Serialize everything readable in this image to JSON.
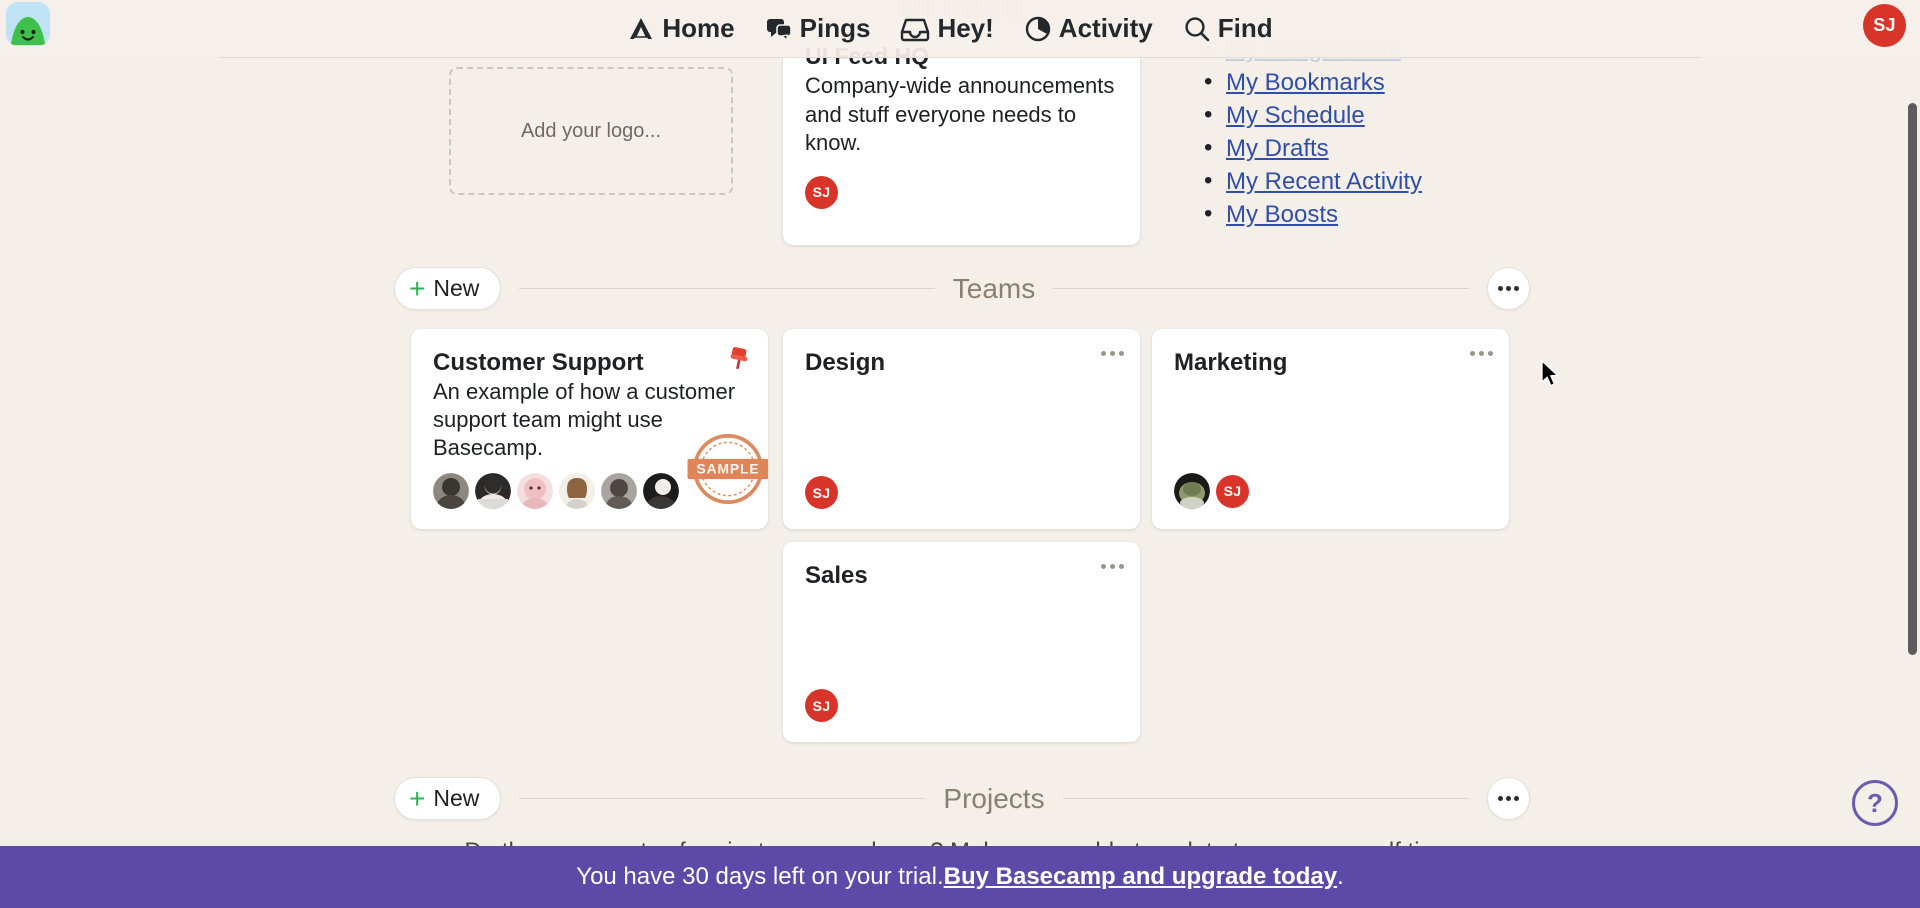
{
  "page": {
    "ghost_title": "UI Feed"
  },
  "header": {
    "logo_name": "basecamp-logo",
    "nav": [
      {
        "label": "Home",
        "icon": "home-icon"
      },
      {
        "label": "Pings",
        "icon": "pings-icon"
      },
      {
        "label": "Hey!",
        "icon": "hey-inbox-icon"
      },
      {
        "label": "Activity",
        "icon": "activity-icon"
      },
      {
        "label": "Find",
        "icon": "search-icon"
      }
    ],
    "avatar_initials": "SJ"
  },
  "logo_drop": {
    "label": "Add your logo..."
  },
  "hq_card": {
    "title": "UI Feed HQ",
    "description": "Company-wide announcements and stuff everyone needs to know.",
    "member_initials": "SJ"
  },
  "my_links": [
    {
      "label": "My Assignments",
      "dimmed": true
    },
    {
      "label": "My Bookmarks",
      "dimmed": false
    },
    {
      "label": "My Schedule",
      "dimmed": false
    },
    {
      "label": "My Drafts",
      "dimmed": false
    },
    {
      "label": "My Recent Activity",
      "dimmed": false
    },
    {
      "label": "My Boosts",
      "dimmed": false
    }
  ],
  "teams_section": {
    "new_label": "New",
    "title": "Teams",
    "menu_icon": "ellipsis-icon"
  },
  "teams": [
    {
      "name": "Customer Support",
      "description": "An example of how a customer support team might use Basecamp.",
      "pinned": true,
      "sample": true,
      "sample_label": "SAMPLE",
      "avatar_count": 6,
      "initials": []
    },
    {
      "name": "Design",
      "description": "",
      "pinned": false,
      "sample": false,
      "avatar_count": 0,
      "initials": [
        "SJ"
      ]
    },
    {
      "name": "Marketing",
      "description": "",
      "pinned": false,
      "sample": false,
      "avatar_count": 1,
      "initials": [
        "SJ"
      ]
    },
    {
      "name": "Sales",
      "description": "",
      "pinned": false,
      "sample": false,
      "avatar_count": 0,
      "initials": [
        "SJ"
      ]
    }
  ],
  "projects_section": {
    "new_label": "New",
    "title": "Projects",
    "menu_icon": "ellipsis-icon",
    "blurb": "Do the same sorts of projects over and over? Make a reusable template to save yourself time."
  },
  "trial_banner": {
    "text": "You have 30 days left on your trial. ",
    "link": "Buy Basecamp and upgrade today",
    "suffix": "."
  },
  "help_button": {
    "label": "?"
  },
  "colors": {
    "background": "#f4efe9",
    "accent_red": "#d8352a",
    "link_blue": "#2f4ea8",
    "trial_purple": "#5b4aa8",
    "plus_green": "#2bb557",
    "section_label": "#8a7f72"
  }
}
